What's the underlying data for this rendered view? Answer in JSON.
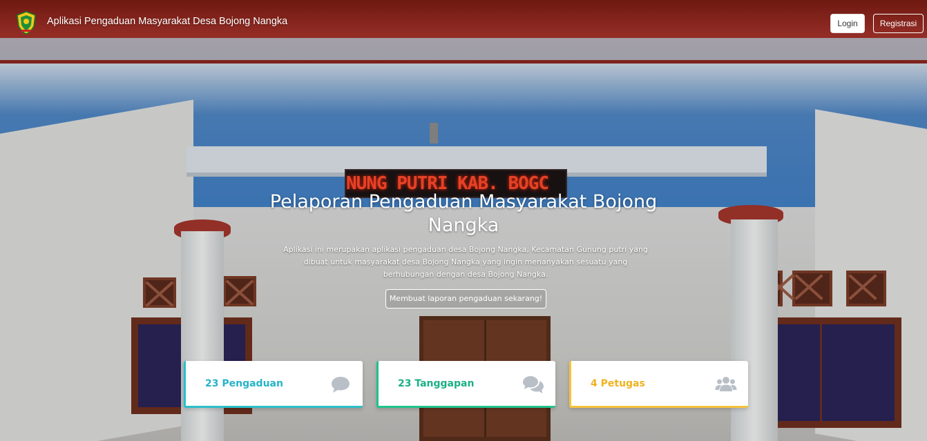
{
  "navbar": {
    "brand": "Aplikasi Pengaduan Masyarakat Desa Bojong Nangka",
    "login_label": "Login",
    "register_label": "Registrasi"
  },
  "background": {
    "led_sign_text": "NUNG PUTRI KAB. BOGC"
  },
  "hero": {
    "title": "Pelaporan Pengaduan Masyarakat Bojong Nangka",
    "description": "Aplikasi ini merupakan aplikasi pengaduan desa Bojong Nangka, Kecamatan Gunung putri yang dibuat untuk masyarakat desa Bojong Nangka yang ingin menanyakan sesuatu yang berhubungan dengan desa Bojong Nangka.",
    "cta_label": "Membuat laporan pengaduan sekarang!"
  },
  "stats": [
    {
      "label": "23 Pengaduan",
      "icon": "comment-icon",
      "color": "#2bbfc9"
    },
    {
      "label": "23 Tanggapan",
      "icon": "comments-icon",
      "color": "#1fc38d"
    },
    {
      "label": "4 Petugas",
      "icon": "users-icon",
      "color": "#f6c33b"
    }
  ]
}
